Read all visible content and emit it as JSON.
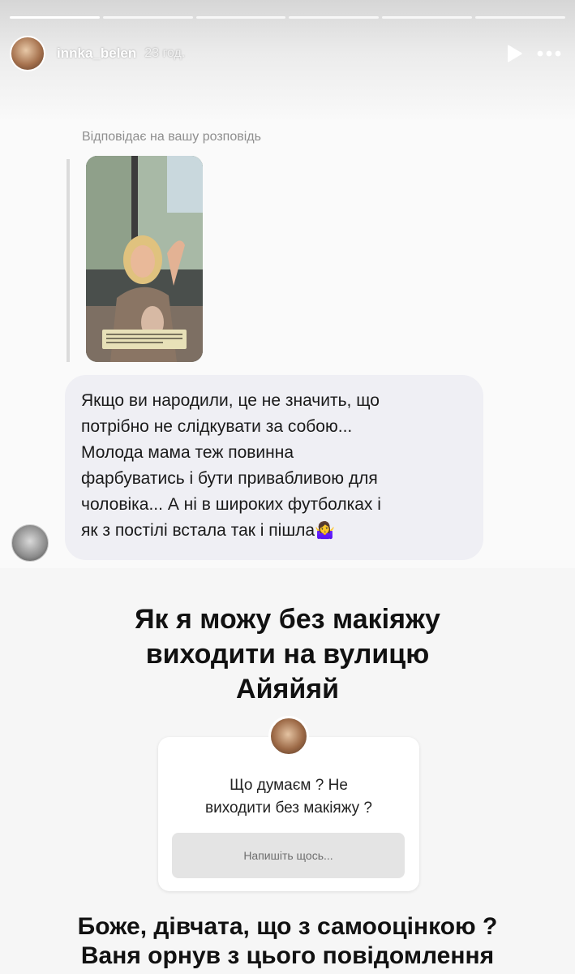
{
  "story": {
    "username": "innka_belen",
    "time": "23 год.",
    "progress_segments": 6,
    "progress_done": 1
  },
  "reply": {
    "label": "Відповідає на вашу розповідь"
  },
  "message": {
    "lines": [
      "Якщо ви народили, це не значить, що",
      "потрібно не слідкувати за собою...",
      "Молода мама теж повинна",
      "фарбуватись і бути привабливою для",
      "чоловіка... А ні в широких футболках і",
      "як з постілі встала так і пішла"
    ],
    "emoji": "🤷‍♀️"
  },
  "overlay": {
    "headline": [
      "Як я можу без макіяжу",
      "виходити на вулицю",
      "Айяйяй"
    ],
    "question": [
      "Що думаєм ? Не",
      "виходити без макіяжу ?"
    ],
    "input_placeholder": "Напишіть щось...",
    "bottom": [
      "Боже, дівчата, що з самооцінкою ?",
      "Ваня орнув з цього повідомлення"
    ]
  },
  "icons": {
    "play": "play-icon",
    "more": "more-icon"
  }
}
